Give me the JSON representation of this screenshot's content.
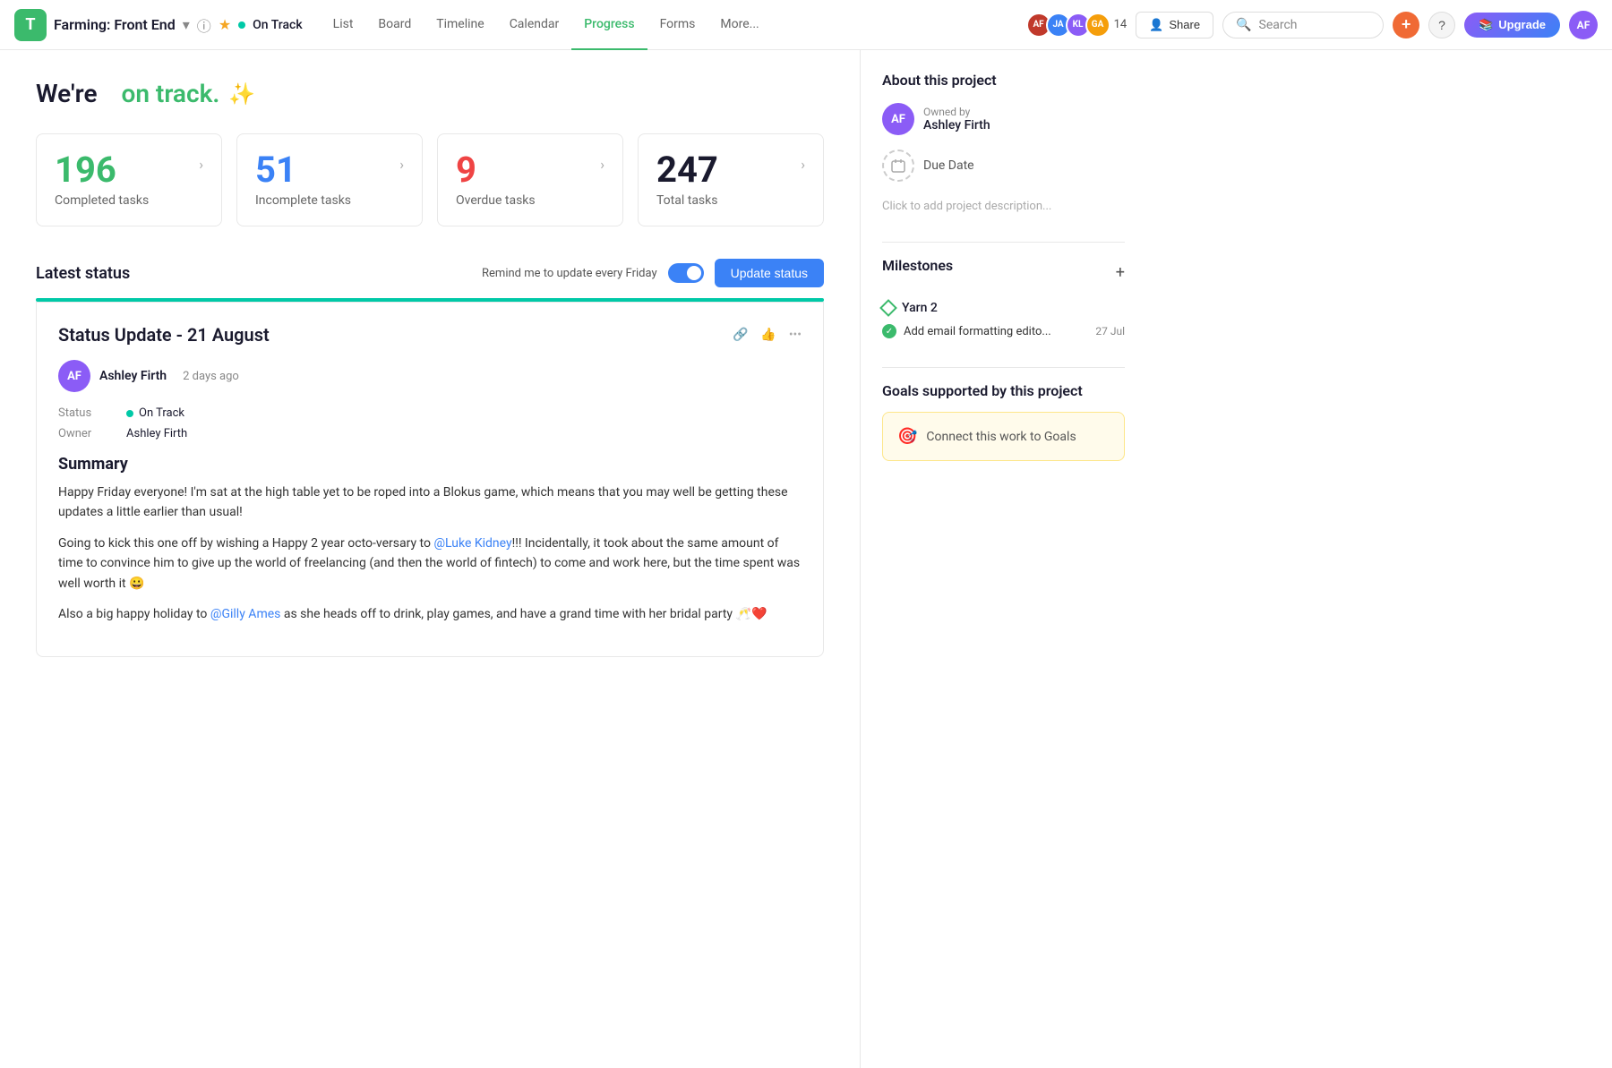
{
  "header": {
    "logo_text": "T",
    "project_name": "Farming: Front End",
    "status_label": "On Track",
    "nav_tabs": [
      {
        "label": "List",
        "active": false
      },
      {
        "label": "Board",
        "active": false
      },
      {
        "label": "Timeline",
        "active": false
      },
      {
        "label": "Calendar",
        "active": false
      },
      {
        "label": "Progress",
        "active": true
      },
      {
        "label": "Forms",
        "active": false
      },
      {
        "label": "More...",
        "active": false
      }
    ],
    "member_count": "14",
    "share_label": "Share",
    "search_placeholder": "Search",
    "add_icon": "+",
    "help_icon": "?",
    "upgrade_label": "Upgrade"
  },
  "page": {
    "heading_static": "We're",
    "heading_dynamic": "on track.",
    "sparkle": "✨"
  },
  "stats": [
    {
      "number": "196",
      "label": "Completed tasks",
      "color": "green"
    },
    {
      "number": "51",
      "label": "Incomplete tasks",
      "color": "blue"
    },
    {
      "number": "9",
      "label": "Overdue tasks",
      "color": "red"
    },
    {
      "number": "247",
      "label": "Total tasks",
      "color": "dark"
    }
  ],
  "status_section": {
    "title": "Latest status",
    "remind_label": "Remind me to update every Friday",
    "update_btn": "Update status",
    "card": {
      "title": "Status Update - 21 August",
      "author": "Ashley Firth",
      "time": "2 days ago",
      "status_key": "Status",
      "status_val": "On Track",
      "owner_key": "Owner",
      "owner_val": "Ashley Firth",
      "summary_title": "Summary",
      "paragraph1": "Happy Friday everyone! I'm sat at the high table yet to be roped into a Blokus game, which means that you may well be getting these updates a little earlier than usual!",
      "paragraph2_prefix": "Going to kick this one off by wishing a Happy 2 year octo-versary to ",
      "mention1": "@Luke Kidney",
      "paragraph2_suffix": "!!! Incidentally, it took about the same amount of time to convince him to give up the world of freelancing (and then the world of fintech) to come and work here, but the time spent was well worth it 😀",
      "paragraph3_prefix": "Also a big happy holiday to ",
      "mention2": "@Gilly Ames",
      "paragraph3_suffix": " as she heads off to drink, play games, and have a grand time with her bridal party 🥂❤️"
    }
  },
  "sidebar": {
    "about_title": "About this project",
    "owned_by_label": "Owned by",
    "owner_name": "Ashley Firth",
    "due_date_label": "Due Date",
    "description_placeholder": "Click to add project description...",
    "milestones_title": "Milestones",
    "milestone_name": "Yarn 2",
    "milestone_task_label": "Add email formatting edito...",
    "milestone_task_date": "27 Jul",
    "goals_title": "Goals supported by this project",
    "connect_goals": "Connect this work to Goals"
  }
}
